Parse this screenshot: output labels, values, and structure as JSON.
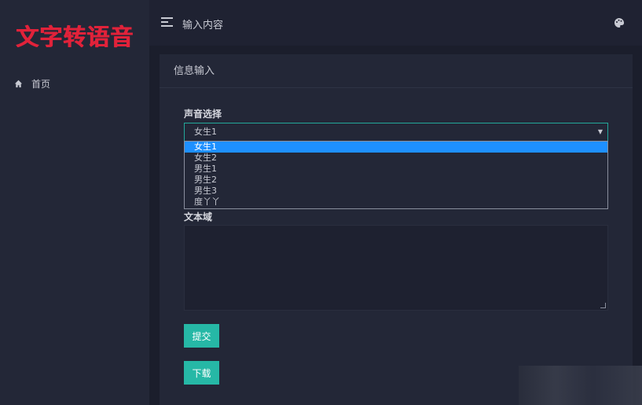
{
  "app": {
    "logo_text": "文字转语音"
  },
  "sidebar": {
    "items": [
      {
        "label": "首页",
        "icon": "home-icon"
      }
    ]
  },
  "header": {
    "title": "输入内容",
    "theme_icon": "palette-icon"
  },
  "card": {
    "title": "信息输入",
    "voice_label": "声音选择",
    "voice_selected": "女生1",
    "voice_options": [
      "女生1",
      "女生2",
      "男生1",
      "男生2",
      "男生3",
      "度丫丫"
    ],
    "textarea_label": "文本域",
    "textarea_value": "",
    "submit_label": "提交",
    "download_label": "下载"
  },
  "colors": {
    "accent": "#26b8a6",
    "logo": "#e1223a",
    "highlight": "#1e90ff"
  }
}
